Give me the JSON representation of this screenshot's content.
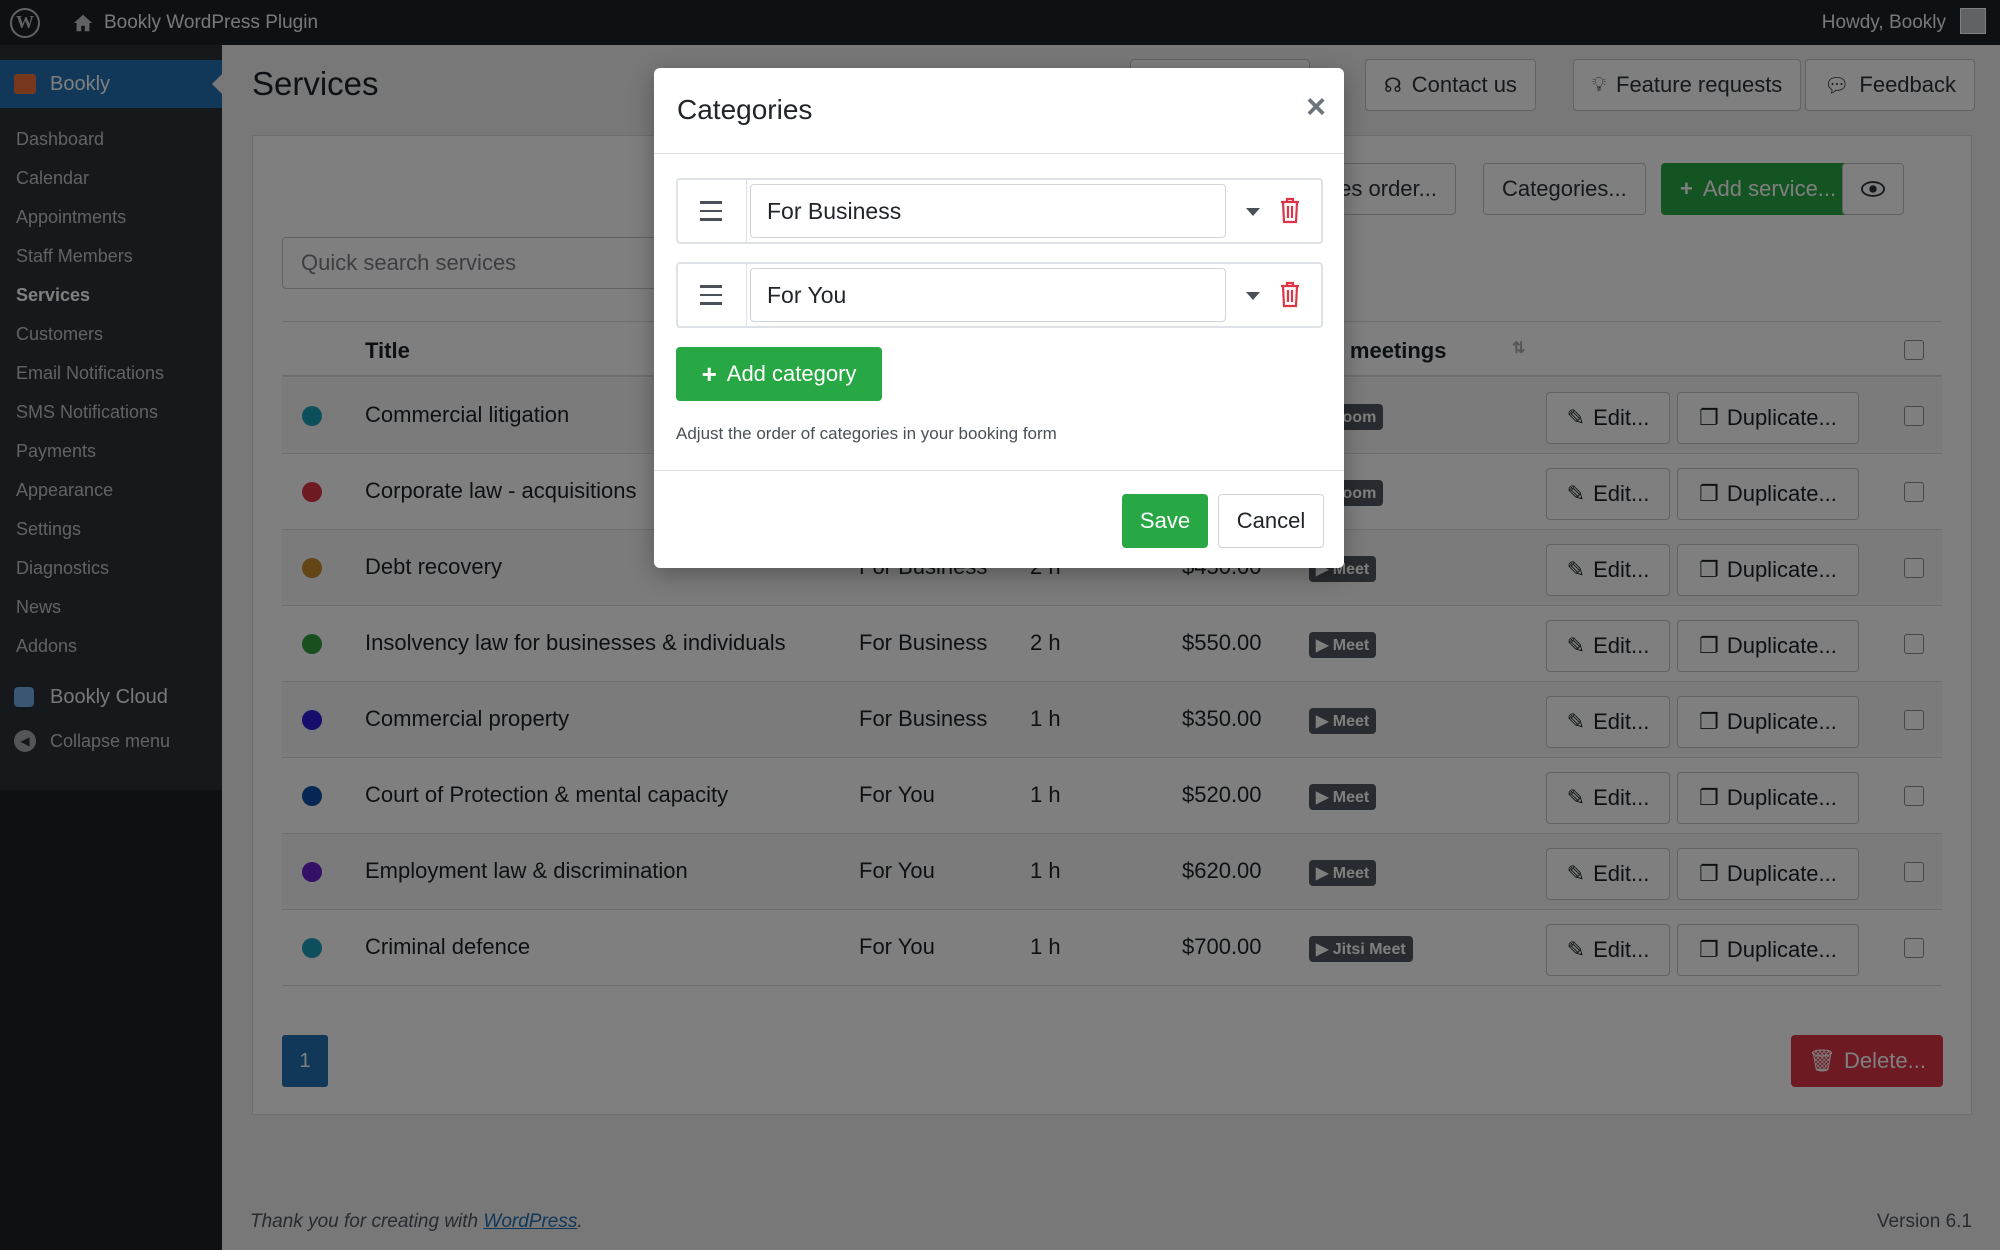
{
  "adminbar": {
    "site_name": "Bookly WordPress Plugin",
    "howdy": "Howdy, Bookly"
  },
  "sidebar": {
    "current": "Bookly",
    "items": [
      {
        "label": "Dashboard"
      },
      {
        "label": "Calendar"
      },
      {
        "label": "Appointments"
      },
      {
        "label": "Staff Members"
      },
      {
        "label": "Services",
        "active": true
      },
      {
        "label": "Customers"
      },
      {
        "label": "Email Notifications"
      },
      {
        "label": "SMS Notifications"
      },
      {
        "label": "Payments"
      },
      {
        "label": "Appearance"
      },
      {
        "label": "Settings"
      },
      {
        "label": "Diagnostics"
      },
      {
        "label": "News"
      },
      {
        "label": "Addons"
      }
    ],
    "cloud": "Bookly Cloud",
    "collapse": "Collapse menu"
  },
  "main": {
    "title": "Services",
    "header_buttons": {
      "contact": "Contact us",
      "feature": "Feature requests",
      "feedback": "Feedback"
    },
    "toolbar": {
      "services_order": "ces order...",
      "categories": "Categories...",
      "add_service": "Add service..."
    },
    "search_placeholder": "Quick search services",
    "table": {
      "col_title": "Title",
      "col_meetings": "ine meetings",
      "edit_label": "Edit...",
      "duplicate_label": "Duplicate...",
      "rows": [
        {
          "color": "#1aa0b8",
          "title": "Commercial litigation",
          "category": "",
          "duration": "",
          "price": "",
          "meet": "Zoom"
        },
        {
          "color": "#dc3545",
          "title": "Corporate law - acquisitions",
          "category": "",
          "duration": "",
          "price": "",
          "meet": "Zoom"
        },
        {
          "color": "#c88a2a",
          "title": "Debt recovery",
          "category": "For Business",
          "duration": "2 h",
          "price": "$450.00",
          "meet": "Meet"
        },
        {
          "color": "#2e9e3f",
          "title": "Insolvency law for businesses & individuals",
          "category": "For Business",
          "duration": "2 h",
          "price": "$550.00",
          "meet": "Meet"
        },
        {
          "color": "#2a1bd6",
          "title": "Commercial property",
          "category": "For Business",
          "duration": "1 h",
          "price": "$350.00",
          "meet": "Meet"
        },
        {
          "color": "#0c4fa8",
          "title": "Court of Protection & mental capacity",
          "category": "For You",
          "duration": "1 h",
          "price": "$520.00",
          "meet": "Meet"
        },
        {
          "color": "#6a1fd0",
          "title": "Employment law & discrimination",
          "category": "For You",
          "duration": "1 h",
          "price": "$620.00",
          "meet": "Meet"
        },
        {
          "color": "#1aa0b8",
          "title": "Criminal defence",
          "category": "For You",
          "duration": "1 h",
          "price": "$700.00",
          "meet": "Jitsi Meet"
        }
      ]
    },
    "page": "1",
    "delete": "Delete..."
  },
  "footer": {
    "text": "Thank you for creating with",
    "link": "WordPress",
    "version": "Version 6.1"
  },
  "modal": {
    "title": "Categories",
    "categories": [
      {
        "name": "For Business"
      },
      {
        "name": "For You"
      }
    ],
    "add_category": "Add category",
    "hint": "Adjust the order of categories in your booking form",
    "save": "Save",
    "cancel": "Cancel"
  }
}
